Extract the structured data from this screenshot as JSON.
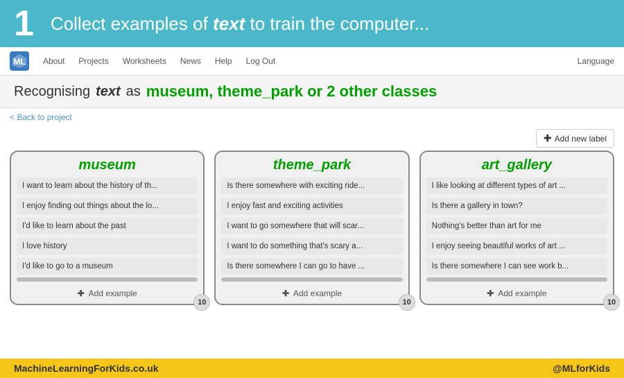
{
  "header": {
    "step": "1",
    "title_before": "Collect examples of ",
    "title_bold": "text",
    "title_after": " to train the computer..."
  },
  "navbar": {
    "items": [
      "About",
      "Projects",
      "Worksheets",
      "News",
      "Help",
      "Log Out"
    ],
    "language": "Language"
  },
  "subtitle": {
    "prefix": "Recognising",
    "text_label": "text",
    "middle": "as",
    "classes": "museum, theme_park or 2 other classes"
  },
  "back_link": "< Back to project",
  "add_label_btn": "Add new label",
  "columns": [
    {
      "id": "museum",
      "label": "museum",
      "examples": [
        "I want to learn about the history of th...",
        "I enjoy finding out things about the lo...",
        "I'd like to learn about the past",
        "I love history",
        "I'd like to go to a museum"
      ],
      "count": "10",
      "add_label": "Add example"
    },
    {
      "id": "theme_park",
      "label": "theme_park",
      "examples": [
        "Is there somewhere with exciting ride...",
        "I enjoy fast and exciting activities",
        "I want to go somewhere that will scar...",
        "I want to do something that's scary a...",
        "Is there somewhere I can go to have ..."
      ],
      "count": "10",
      "add_label": "Add example"
    },
    {
      "id": "art_gallery",
      "label": "art_gallery",
      "examples": [
        "I like looking at different types of art ...",
        "Is there a gallery in town?",
        "Nothing's better than art for me",
        "I enjoy seeing beautiful works of art ...",
        "Is there somewhere I can see work b..."
      ],
      "count": "10",
      "add_label": "Add example"
    }
  ],
  "footer": {
    "left": "MachineLearningForKids.co.uk",
    "right": "@MLforKids"
  }
}
